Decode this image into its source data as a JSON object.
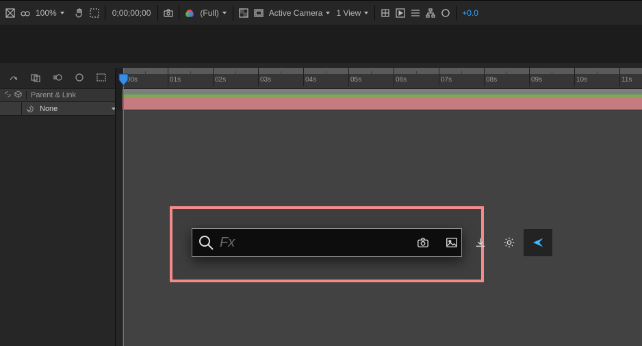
{
  "topbar": {
    "zoom": "100%",
    "timecode": "0;00;00;00",
    "resolution": "(Full)",
    "view_mode": "Active Camera",
    "view_count": "1 View",
    "exposure": "+0.0"
  },
  "timeline": {
    "ticks": [
      ":00s",
      "01s",
      "02s",
      "03s",
      "04s",
      "05s",
      "06s",
      "07s",
      "08s",
      "09s",
      "10s",
      "11s"
    ],
    "header_label": "Parent & Link",
    "row_parent": "None"
  },
  "fx": {
    "placeholder": "Fx"
  }
}
